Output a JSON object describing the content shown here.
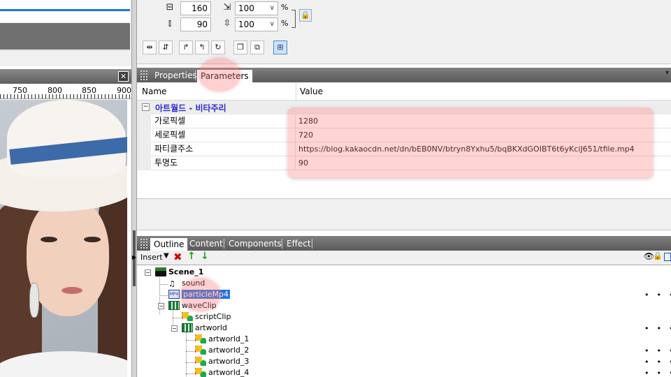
{
  "stage": {
    "close_label": "✕",
    "ruler_labels": [
      "750",
      "800",
      "850",
      "900"
    ]
  },
  "transform": {
    "width_value": "160",
    "height_value": "90",
    "scale_x": "100",
    "scale_y": "100",
    "percent_sign": "%"
  },
  "properties_panel": {
    "tabs": [
      "Properties",
      "Parameters"
    ],
    "active_tab": "Parameters",
    "col_name": "Name",
    "col_value": "Value",
    "group_title": "아트월드 - 비타주리",
    "rows": [
      {
        "name": "가로픽셀",
        "value": "1280"
      },
      {
        "name": "세로픽셀",
        "value": "720"
      },
      {
        "name": "파티클주소",
        "value": "https://blog.kakaocdn.net/dn/bEB0NV/btryn8Yxhu5/bqBKXdGOIBT6t6yKciJ651/tfile.mp4"
      },
      {
        "name": "투명도",
        "value": "90"
      }
    ]
  },
  "outline_panel": {
    "tabs": [
      "Outline",
      "Content",
      "Components",
      "Effect"
    ],
    "active_tab": "Outline",
    "insert_label": "Insert",
    "tree": [
      {
        "label": "Scene_1",
        "icon": "scene-icon"
      },
      {
        "label": "sound",
        "icon": "music-note-icon"
      },
      {
        "label": "particleMp4",
        "icon": "mp4-icon",
        "selected": true
      },
      {
        "label": "waveClip",
        "icon": "film-icon"
      },
      {
        "label": "scriptClip",
        "icon": "shape-icon"
      },
      {
        "label": "artworld",
        "icon": "film-icon"
      },
      {
        "label": "artworld_1",
        "icon": "shape-icon"
      },
      {
        "label": "artworld_2",
        "icon": "shape-icon"
      },
      {
        "label": "artworld_3",
        "icon": "shape-icon"
      },
      {
        "label": "artworld_4",
        "icon": "shape-icon"
      }
    ]
  },
  "colors": {
    "group_title": "#2c2ccf",
    "selection": "#1f73d9",
    "highlight": "#ff7878"
  }
}
